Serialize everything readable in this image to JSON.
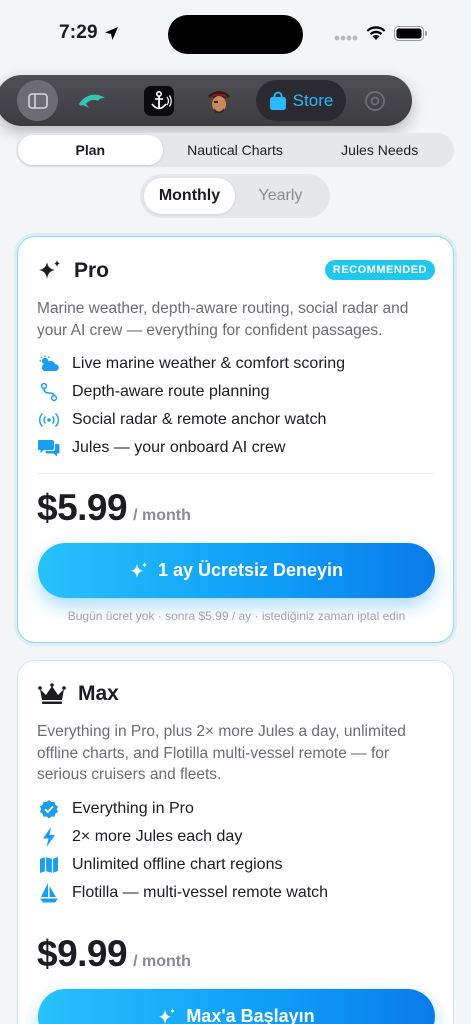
{
  "status_bar": {
    "time": "7:29"
  },
  "toolbar": {
    "store_label": "Store"
  },
  "tabs": [
    {
      "label": "Plan",
      "active": true
    },
    {
      "label": "Nautical Charts",
      "active": false
    },
    {
      "label": "Jules Needs",
      "active": false
    }
  ],
  "billing_period": {
    "options": [
      {
        "label": "Monthly",
        "active": true
      },
      {
        "label": "Yearly",
        "active": false
      }
    ]
  },
  "plans": [
    {
      "name": "Pro",
      "badge": "RECOMMENDED",
      "description": "Marine weather, depth-aware routing, social radar and your AI crew — everything for confident passages.",
      "features": [
        {
          "icon": "weather-icon",
          "label": "Live marine weather & comfort scoring"
        },
        {
          "icon": "route-icon",
          "label": "Depth-aware route planning"
        },
        {
          "icon": "radar-icon",
          "label": "Social radar & remote anchor watch"
        },
        {
          "icon": "chat-icon",
          "label": "Jules — your onboard AI crew"
        }
      ],
      "price": "$5.99",
      "period": "/ month",
      "cta": "1 ay Ücretsiz Deneyin",
      "fine_print": "Bugün ücret yok · sonra $5.99 / ay · istediğiniz zaman iptal edin"
    },
    {
      "name": "Max",
      "description": "Everything in Pro, plus 2× more Jules a day, unlimited offline charts, and Flotilla multi-vessel remote — for serious cruisers and fleets.",
      "features": [
        {
          "icon": "verified-icon",
          "label": "Everything in Pro"
        },
        {
          "icon": "bolt-icon",
          "label": "2× more Jules each day"
        },
        {
          "icon": "map-icon",
          "label": "Unlimited offline chart regions"
        },
        {
          "icon": "sailboat-icon",
          "label": "Flotilla — multi-vessel remote watch"
        }
      ],
      "price": "$9.99",
      "period": "/ month",
      "cta": "Max'a Başlayın"
    }
  ],
  "colors": {
    "accent": "#0e9cf7",
    "badge": "#1fc8ec",
    "icon": "#1a9ff0"
  }
}
